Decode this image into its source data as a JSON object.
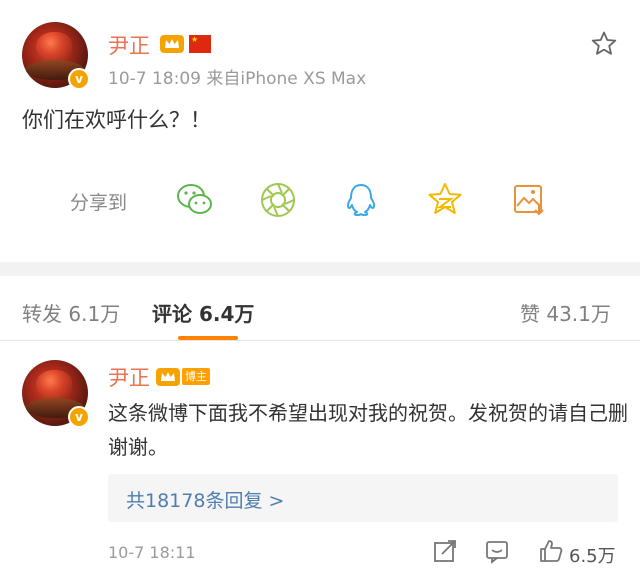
{
  "post": {
    "author": "尹正",
    "time_source": "10-7 18:09  来自iPhone XS Max",
    "text": "你们在欢呼什么？！",
    "share_label": "分享到",
    "share_targets": [
      "wechat-icon",
      "moments-icon",
      "qq-icon",
      "qzone-icon",
      "save-image-icon"
    ]
  },
  "tabs": {
    "repost": "转发 6.1万",
    "comment": "评论 6.4万",
    "like": "赞 43.1万"
  },
  "comment": {
    "author": "尹正",
    "badge": "博主",
    "text": "这条微博下面我不希望出现对我的祝贺。发祝贺的请自己删谢谢。",
    "replies_link": "共18178条回复 >",
    "time": "10-7 18:11",
    "likes": "6.5万"
  },
  "colors": {
    "username": "#eb7350",
    "tab_underline": "#ff8200",
    "link": "#507daf",
    "vip_badge": "#f5a300"
  }
}
